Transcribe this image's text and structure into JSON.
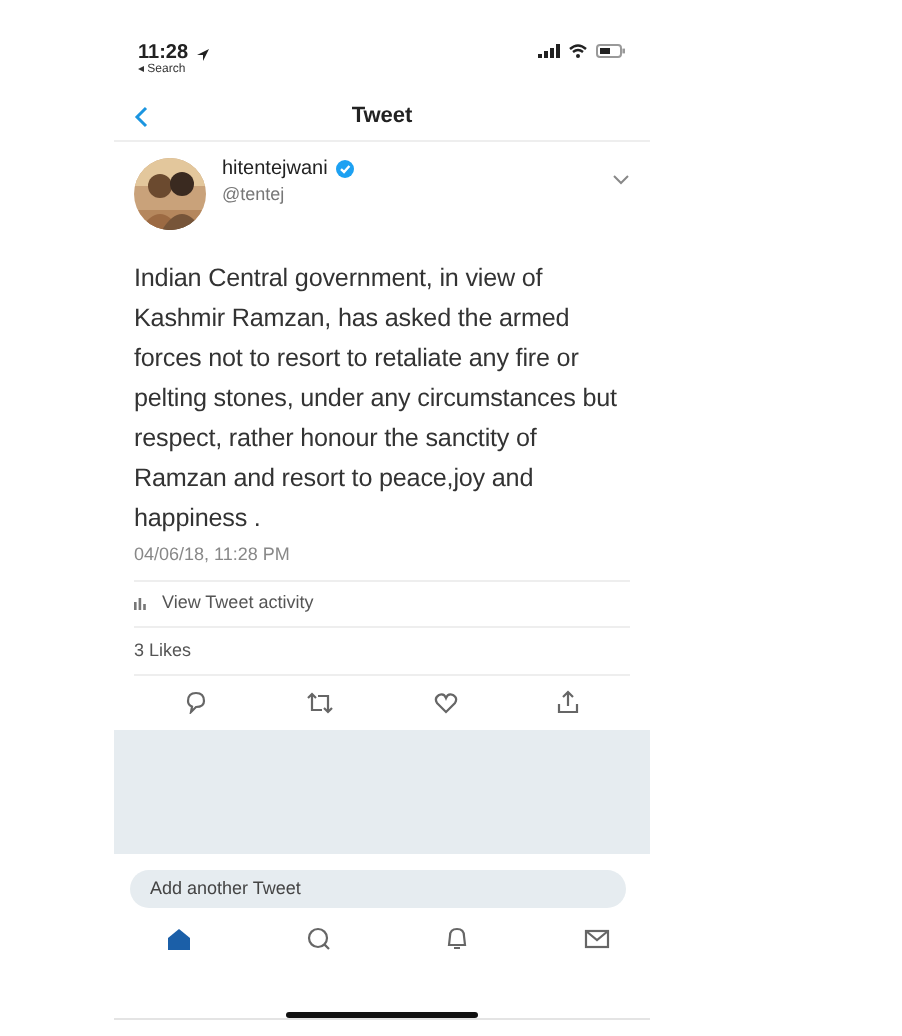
{
  "status_bar": {
    "time": "11:28",
    "back_label": "◂ Search"
  },
  "header": {
    "title": "Tweet"
  },
  "tweet": {
    "author": "hitentejwani",
    "handle": "@tentej",
    "verified": true,
    "text": "Indian Central government, in view of Kashmir Ramzan, has asked the armed forces not to resort to retaliate any fire or pelting stones, under any circumstances but respect, rather honour the sanctity of Ramzan and resort to peace,joy and happiness .",
    "timestamp": "04/06/18, 11:28 PM",
    "activity_link": "View Tweet activity",
    "likes": "3 Likes"
  },
  "reply_field": {
    "placeholder": "Add another Tweet"
  },
  "tab_bar": [
    {
      "kind": "home",
      "selected": true
    },
    {
      "kind": "search",
      "selected": false
    },
    {
      "kind": "notifications",
      "selected": false
    },
    {
      "kind": "messages",
      "selected": false
    }
  ]
}
